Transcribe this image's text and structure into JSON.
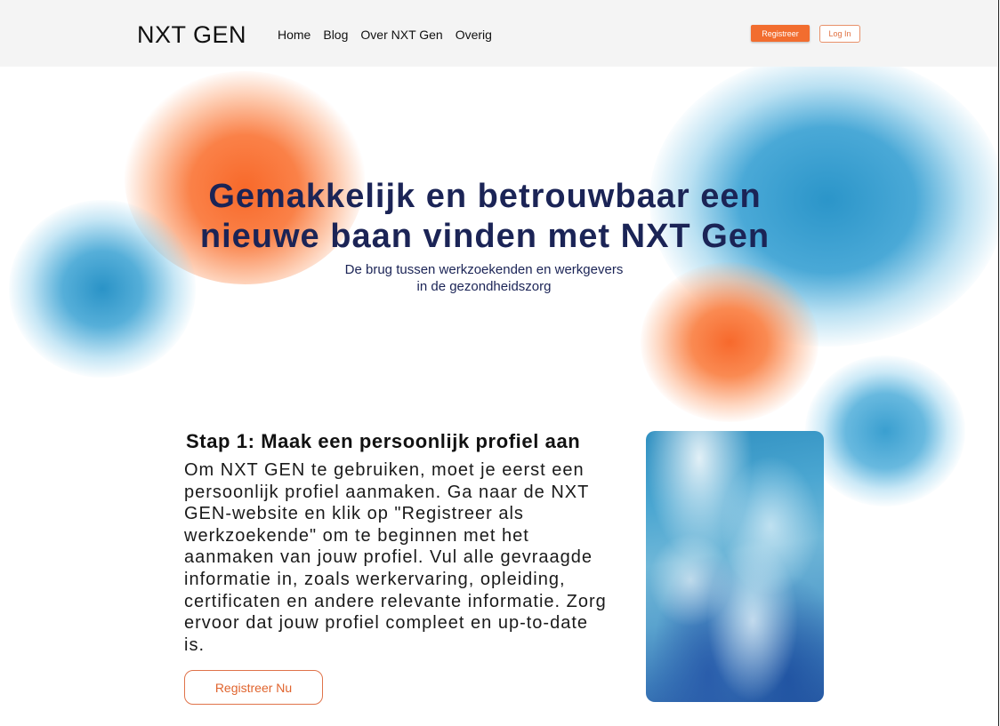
{
  "header": {
    "logo": "NXT GEN",
    "nav": [
      "Home",
      "Blog",
      "Over NXT Gen",
      "Overig"
    ],
    "register_label": "Registreer",
    "login_label": "Log In"
  },
  "hero": {
    "title_line1": "Gemakkelijk en betrouwbaar een",
    "title_line2": "nieuwe baan vinden met NXT Gen",
    "subtitle_line1": "De brug tussen werkzoekenden en werkgevers",
    "subtitle_line2": "in de gezondheidszorg"
  },
  "step": {
    "title": "Stap 1: Maak een persoonlijk profiel aan",
    "body": "Om NXT GEN te gebruiken, moet je eerst een persoonlijk profiel aanmaken. Ga naar de NXT GEN-website en klik op \"Registreer als werkzoekende\" om te beginnen met het aanmaken van jouw profiel. Vul alle gevraagde informatie in, zoals werkervaring, opleiding, certificaten en andere relevante informatie. Zorg ervoor dat jouw profiel compleet en up-to-date is.",
    "cta_label": "Registreer Nu"
  },
  "colors": {
    "accent": "#f26d2f",
    "heading": "#1b2456",
    "blob_blue": "#2b95c9",
    "blob_orange": "#f8692a"
  }
}
